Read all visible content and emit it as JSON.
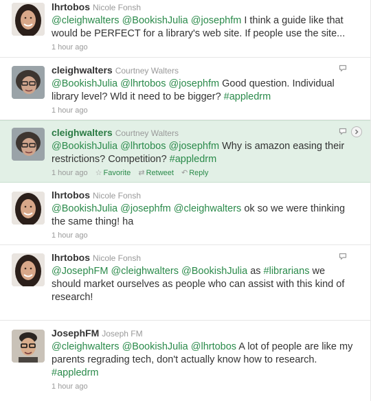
{
  "tweets": [
    {
      "screen_name": "lhrtobos",
      "full_name": "Nicole Fonsh",
      "parts": [
        {
          "t": "@cleighwalters",
          "k": "mention"
        },
        {
          "t": " "
        },
        {
          "t": "@BookishJulia",
          "k": "mention"
        },
        {
          "t": " "
        },
        {
          "t": "@josephfm",
          "k": "mention"
        },
        {
          "t": " I think a guide like that would be PERFECT for a library's web site. If people use the site..."
        }
      ],
      "time": "1 hour ago",
      "avatar": "woman-dark-hair"
    },
    {
      "screen_name": "cleighwalters",
      "full_name": "Courtney Walters",
      "parts": [
        {
          "t": "@BookishJulia",
          "k": "mention"
        },
        {
          "t": " "
        },
        {
          "t": "@lhrtobos",
          "k": "mention"
        },
        {
          "t": " "
        },
        {
          "t": "@josephfm",
          "k": "mention"
        },
        {
          "t": " Good question. Individual library level? Wld it need to be bigger? "
        },
        {
          "t": "#appledrm",
          "k": "hashtag"
        }
      ],
      "time": "1 hour ago",
      "avatar": "woman-glasses"
    },
    {
      "screen_name": "cleighwalters",
      "full_name": "Courtney Walters",
      "parts": [
        {
          "t": "@BookishJulia",
          "k": "mention"
        },
        {
          "t": " "
        },
        {
          "t": "@lhrtobos",
          "k": "mention"
        },
        {
          "t": " "
        },
        {
          "t": "@josephfm",
          "k": "mention"
        },
        {
          "t": " Why is amazon easing their restrictions? Competition? "
        },
        {
          "t": "#appledrm",
          "k": "hashtag"
        }
      ],
      "time": "1 hour ago",
      "avatar": "woman-glasses",
      "actions": {
        "favorite": "Favorite",
        "retweet": "Retweet",
        "reply": "Reply"
      }
    },
    {
      "screen_name": "lhrtobos",
      "full_name": "Nicole Fonsh",
      "parts": [
        {
          "t": "@BookishJulia",
          "k": "mention"
        },
        {
          "t": " "
        },
        {
          "t": "@josephfm",
          "k": "mention"
        },
        {
          "t": " "
        },
        {
          "t": "@cleighwalters",
          "k": "mention"
        },
        {
          "t": " ok so we were thinking the same thing! ha"
        }
      ],
      "time": "1 hour ago",
      "avatar": "woman-dark-hair"
    },
    {
      "screen_name": "lhrtobos",
      "full_name": "Nicole Fonsh",
      "parts": [
        {
          "t": "@JosephFM",
          "k": "mention"
        },
        {
          "t": " "
        },
        {
          "t": "@cleighwalters",
          "k": "mention"
        },
        {
          "t": " "
        },
        {
          "t": "@BookishJulia",
          "k": "mention"
        },
        {
          "t": " as "
        },
        {
          "t": "#librarians",
          "k": "hashtag"
        },
        {
          "t": " we should market ourselves as people who can assist with this kind of research!"
        }
      ],
      "time": "1 hour ago",
      "avatar": "woman-dark-hair"
    },
    {
      "screen_name": "JosephFM",
      "full_name": "Joseph FM",
      "parts": [
        {
          "t": "@cleighwalters",
          "k": "mention"
        },
        {
          "t": " "
        },
        {
          "t": "@BookishJulia",
          "k": "mention"
        },
        {
          "t": " "
        },
        {
          "t": "@lhrtobos",
          "k": "mention"
        },
        {
          "t": " A lot of people are like my parents regrading tech, don't actually know how to research. "
        },
        {
          "t": "#appledrm",
          "k": "hashtag"
        }
      ],
      "time": "1 hour ago",
      "avatar": "man-glasses"
    }
  ]
}
